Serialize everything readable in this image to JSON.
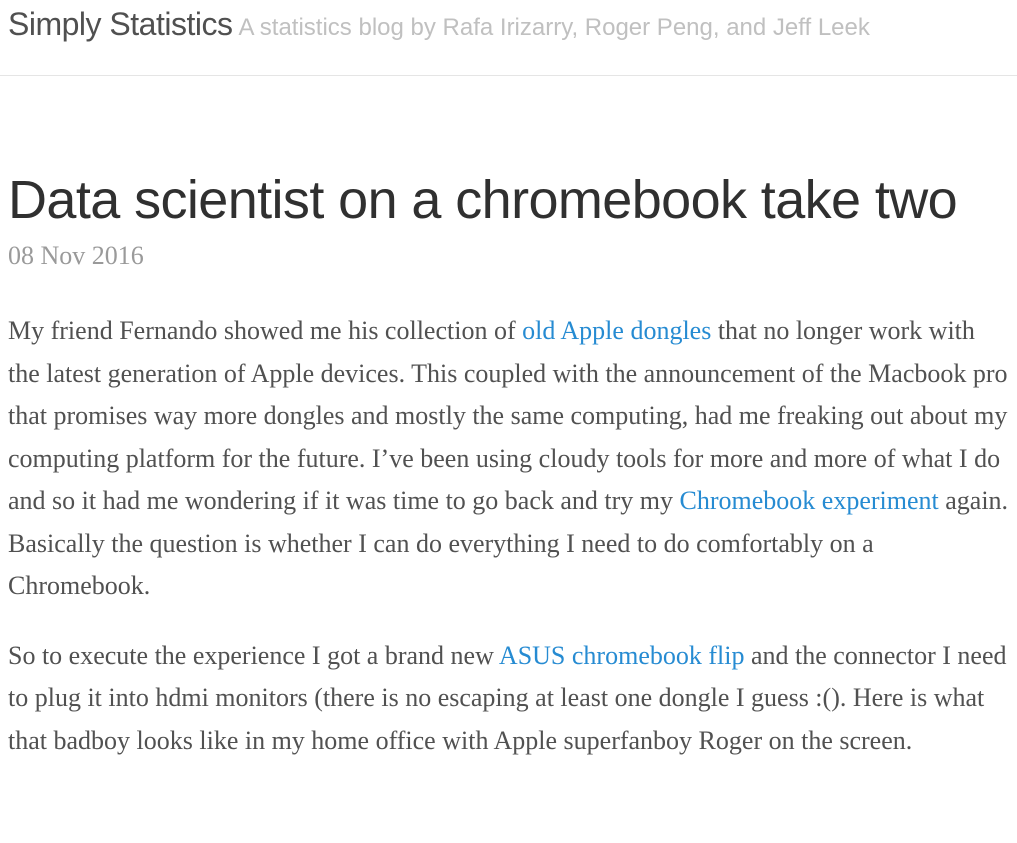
{
  "site": {
    "title": "Simply Statistics",
    "tagline": "A statistics blog by Rafa Irizarry, Roger Peng, and Jeff Leek"
  },
  "post": {
    "title": "Data scientist on a chromebook take two",
    "date": "08 Nov 2016",
    "paragraph1": {
      "text_before_link1": "My friend Fernando showed me his collection of ",
      "link1": "old Apple dongles",
      "text_after_link1": " that no longer work with the latest generation of Apple devices. This coupled with the announcement of the Macbook pro that promises way more dongles and mostly the same computing, had me freaking out about my computing platform for the future. I’ve been using cloudy tools for more and more of what I do and so it had me wondering if it was time to go back and try my ",
      "link2": "Chromebook experiment",
      "text_after_link2": " again. Basically the question is whether I can do everything I need to do comfortably on a Chromebook."
    },
    "paragraph2": {
      "text_before_link": "So to execute the experience I got a brand new ",
      "link": "ASUS chromebook flip",
      "text_after_link": " and the connector I need to plug it into hdmi monitors (there is no escaping at least one dongle I guess :(). Here is what that badboy looks like in my home office with Apple superfanboy Roger on the screen."
    }
  }
}
